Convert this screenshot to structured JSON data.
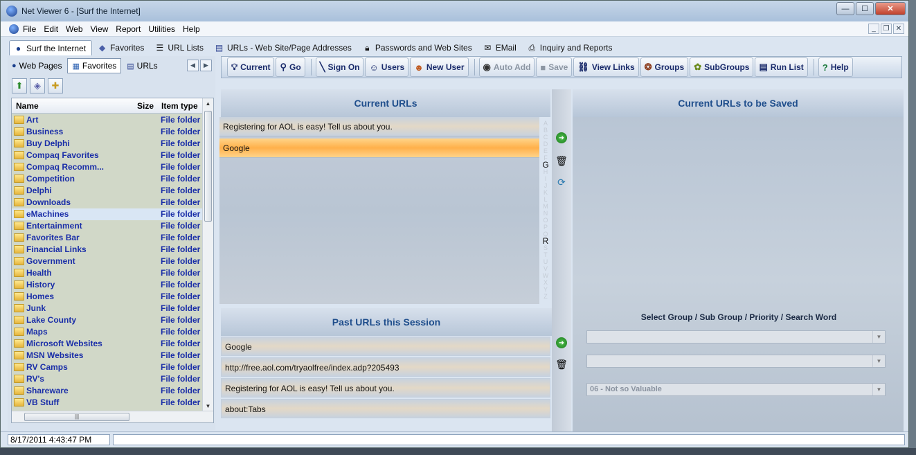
{
  "window": {
    "title": "Net Viewer 6 - [Surf the Internet]",
    "min_glyph": "—",
    "max_glyph": "☐",
    "close_glyph": "✕"
  },
  "menu": {
    "items": [
      "File",
      "Edit",
      "Web",
      "View",
      "Report",
      "Utilities",
      "Help"
    ]
  },
  "mdi_controls": {
    "min": "_",
    "restore": "❐",
    "close": "✕"
  },
  "main_tabs": [
    {
      "label": "Surf the Internet",
      "icon": "globe-icon"
    },
    {
      "label": "Favorites",
      "icon": "bookmark-icon"
    },
    {
      "label": "URL Lists",
      "icon": "list-icon"
    },
    {
      "label": "URLs - Web Site/Page Addresses",
      "icon": "url-icon"
    },
    {
      "label": "Passwords and Web Sites",
      "icon": "lock-icon"
    },
    {
      "label": "EMail",
      "icon": "mail-icon"
    },
    {
      "label": "Inquiry and Reports",
      "icon": "printer-icon"
    }
  ],
  "sub_tabs": [
    {
      "label": "Web Pages",
      "icon": "globe-icon"
    },
    {
      "label": "Favorites",
      "icon": "table-icon"
    },
    {
      "label": "URLs",
      "icon": "url-icon"
    }
  ],
  "file_list": {
    "columns": {
      "name": "Name",
      "size": "Size",
      "type": "Item type"
    },
    "rows": [
      {
        "name": "Art",
        "type": "File folder"
      },
      {
        "name": "Business",
        "type": "File folder"
      },
      {
        "name": "Buy Delphi",
        "type": "File folder"
      },
      {
        "name": "Compaq Favorites",
        "type": "File folder"
      },
      {
        "name": "Compaq Recomm...",
        "type": "File folder"
      },
      {
        "name": "Competition",
        "type": "File folder"
      },
      {
        "name": "Delphi",
        "type": "File folder"
      },
      {
        "name": "Downloads",
        "type": "File folder"
      },
      {
        "name": "eMachines",
        "type": "File folder"
      },
      {
        "name": "Entertainment",
        "type": "File folder"
      },
      {
        "name": "Favorites Bar",
        "type": "File folder"
      },
      {
        "name": "Financial Links",
        "type": "File folder"
      },
      {
        "name": "Government",
        "type": "File folder"
      },
      {
        "name": "Health",
        "type": "File folder"
      },
      {
        "name": "History",
        "type": "File folder"
      },
      {
        "name": "Homes",
        "type": "File folder"
      },
      {
        "name": "Junk",
        "type": "File folder"
      },
      {
        "name": "Lake County",
        "type": "File folder"
      },
      {
        "name": "Maps",
        "type": "File folder"
      },
      {
        "name": "Microsoft Websites",
        "type": "File folder"
      },
      {
        "name": "MSN Websites",
        "type": "File folder"
      },
      {
        "name": "RV Camps",
        "type": "File folder"
      },
      {
        "name": "RV's",
        "type": "File folder"
      },
      {
        "name": "Shareware",
        "type": "File folder"
      },
      {
        "name": "VB Stuff",
        "type": "File folder"
      }
    ],
    "selected_index": 8
  },
  "toolbar": {
    "current": "Current",
    "go": "Go",
    "sign_on": "Sign On",
    "users": "Users",
    "new_user": "New User",
    "auto_add": "Auto Add",
    "save": "Save",
    "view_links": "View Links",
    "groups": "Groups",
    "subgroups": "SubGroups",
    "run_list": "Run List",
    "help": "Help"
  },
  "current_urls": {
    "header": "Current URLs",
    "items": [
      "Registering for AOL is easy! Tell us about you.",
      "Google"
    ],
    "highlighted_index": 1,
    "alpha_index": [
      "A",
      "B",
      "C",
      "D",
      "E",
      "F",
      "G",
      "H",
      "I",
      "J",
      "K",
      "L",
      "M",
      "N",
      "O",
      "P",
      "Q",
      "R",
      "S",
      "T",
      "U",
      "V",
      "W",
      "X",
      "Y",
      "Z"
    ],
    "alpha_active": [
      "G",
      "R"
    ]
  },
  "past_urls": {
    "header": "Past URLs this Session",
    "items": [
      "Google",
      "http://free.aol.com/tryaolfree/index.adp?205493",
      "Registering for AOL is easy! Tell us about you.",
      "about:Tabs"
    ]
  },
  "save_panel": {
    "header": "Current URLs to be Saved",
    "select_label": "Select Group / Sub Group / Priority / Search Word",
    "combos": [
      "",
      "",
      "06 - Not so Valuable"
    ]
  },
  "status": {
    "datetime": "8/17/2011 4:43:47 PM"
  }
}
